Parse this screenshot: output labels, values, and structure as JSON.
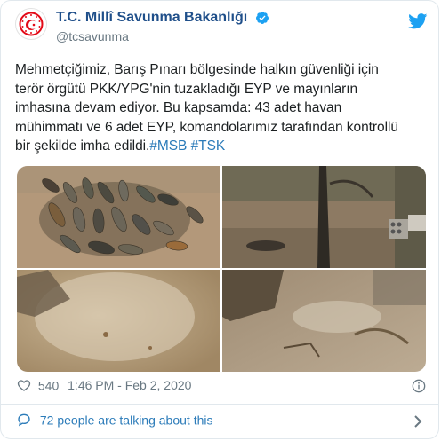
{
  "tweet": {
    "display_name": "T.C. Millî Savunma Bakanlığı",
    "handle": "@tcsavunma",
    "text_plain": "Mehmetçiğimiz, Barış Pınarı bölgesinde halkın güvenliği için\nterör örgütü PKK/YPG'nin tuzakladığı EYP ve mayınların\nimhasına devam ediyor. Bu kapsamda: 43 adet havan\nmühimmatı ve 6 adet EYP, komandolarımız tarafından kontrollü\nbir şekilde imha edildi.",
    "hashtag_1": "#MSB",
    "hashtag_2": "#TSK",
    "likes": "540",
    "timestamp": "1:46 PM - Feb 2, 2020",
    "conversation": "72 people are talking about this"
  },
  "icons": {
    "avatar": "msb-emblem-icon",
    "verified": "verified-badge-icon",
    "logo": "twitter-bird-icon",
    "like": "heart-icon",
    "info": "info-icon",
    "conversation": "chat-bubble-icon",
    "chevron": "chevron-right-icon"
  },
  "colors": {
    "name": "#1f4f8a",
    "link": "#2b7bb9",
    "muted": "#697882",
    "emblem": "#e30a17",
    "twitter": "#1da1f2"
  }
}
